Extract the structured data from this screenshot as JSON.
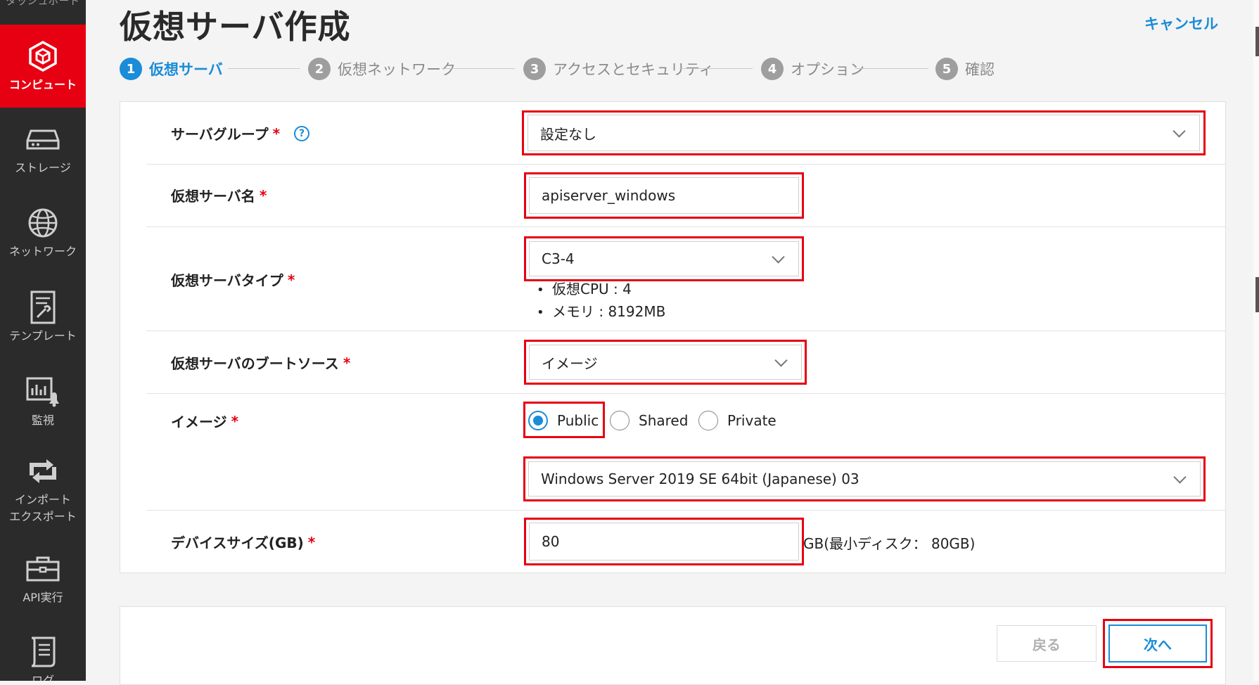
{
  "sidebar": {
    "cut_label": "ダッシュボード",
    "items": [
      {
        "label": "コンピュート",
        "icon": "cube-icon"
      },
      {
        "label": "ストレージ",
        "icon": "storage-icon"
      },
      {
        "label": "ネットワーク",
        "icon": "globe-icon"
      },
      {
        "label": "テンプレート",
        "icon": "template-icon"
      },
      {
        "label": "監視",
        "icon": "monitor-icon"
      },
      {
        "label": "インポート\nエクスポート",
        "icon": "import-export-icon"
      },
      {
        "label": "API実行",
        "icon": "toolbox-icon"
      },
      {
        "label": "ログ",
        "icon": "log-icon"
      }
    ]
  },
  "header": {
    "title": "仮想サーバ作成",
    "cancel": "キャンセル"
  },
  "steps": [
    {
      "num": "1",
      "label": "仮想サーバ"
    },
    {
      "num": "2",
      "label": "仮想ネットワーク"
    },
    {
      "num": "3",
      "label": "アクセスとセキュリティ"
    },
    {
      "num": "4",
      "label": "オプション"
    },
    {
      "num": "5",
      "label": "確認"
    }
  ],
  "form": {
    "required_mark": "*",
    "help_icon": "?",
    "server_group": {
      "label": "サーバグループ",
      "value": "設定なし"
    },
    "server_name": {
      "label": "仮想サーバ名",
      "value": "apiserver_windows"
    },
    "server_type": {
      "label": "仮想サーバタイプ",
      "value": "C3-4",
      "cpu": "仮想CPU : 4",
      "memory": "メモリ : 8192MB"
    },
    "boot_source": {
      "label": "仮想サーバのブートソース",
      "value": "イメージ"
    },
    "image": {
      "label": "イメージ",
      "options": [
        "Public",
        "Shared",
        "Private"
      ],
      "selected": "Public",
      "value": "Windows Server 2019 SE 64bit (Japanese) 03"
    },
    "device_size": {
      "label": "デバイスサイズ(GB)",
      "value": "80",
      "hint": "GB(最小ディスク： 80GB)"
    }
  },
  "actions": {
    "back": "戻る",
    "next": "次へ"
  },
  "colors": {
    "accent": "#1a8cd8",
    "brand_red": "#e60012",
    "sidebar": "#2b2b2b"
  }
}
